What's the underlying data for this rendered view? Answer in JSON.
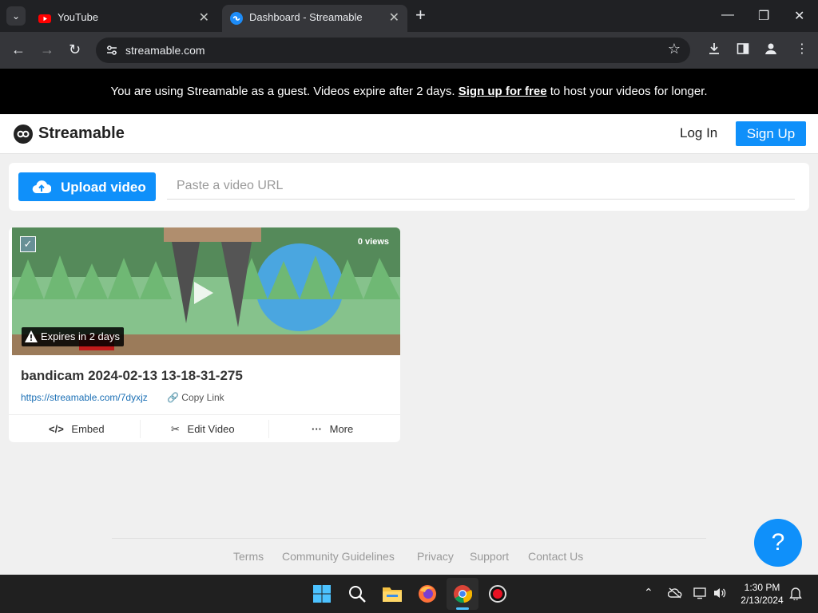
{
  "browser": {
    "tabs": [
      {
        "title": "YouTube",
        "icon": "youtube-icon"
      },
      {
        "title": "Dashboard - Streamable",
        "icon": "streamable-icon",
        "active": true
      }
    ],
    "url": "streamable.com"
  },
  "guest_banner": {
    "prefix": "You are using Streamable as a guest. Videos expire after 2 days. ",
    "link": "Sign up for free",
    "suffix": " to host your videos for longer."
  },
  "header": {
    "brand": "Streamable",
    "login": "Log In",
    "signup": "Sign Up"
  },
  "upload": {
    "button": "Upload video",
    "placeholder": "Paste a video URL"
  },
  "video": {
    "views": "0 views",
    "expires": "Expires in 2 days",
    "title": "bandicam 2024-02-13 13-18-31-275",
    "link": "https://streamable.com/7dyxjz",
    "copy": "Copy Link",
    "actions": {
      "embed": "Embed",
      "edit": "Edit Video",
      "more": "More"
    }
  },
  "footer": {
    "links": [
      "Terms",
      "Community Guidelines",
      "Privacy",
      "Support",
      "Contact Us"
    ]
  },
  "help": "?",
  "taskbar": {
    "time": "1:30 PM",
    "date": "2/13/2024"
  },
  "colors": {
    "accent": "#0f90fa",
    "banner": "#000000",
    "chrome": "#202124"
  }
}
